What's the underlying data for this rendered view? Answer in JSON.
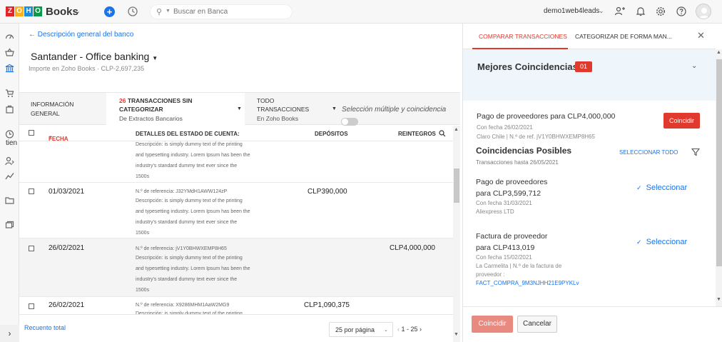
{
  "topbar": {
    "logo_letters": [
      "Z",
      "O",
      "H",
      "O"
    ],
    "logo_colors": [
      "#e42527",
      "#f9b21d",
      "#1a8cd8",
      "#089949"
    ],
    "product": "Books",
    "search_placeholder": "Buscar en Banca",
    "org_name": "demo1web4leads"
  },
  "leftnav": {
    "partial_label": "tien",
    "icons": [
      "dashboard-icon",
      "items-icon",
      "banking-icon",
      "sales-icon",
      "purchases-icon",
      "time-icon",
      "contacts-icon",
      "reports-icon",
      "documents-icon",
      "projects-icon"
    ]
  },
  "main": {
    "back_link": "Descripción general del banco",
    "account_title": "Santander - Office banking",
    "account_subtitle": "Importe en Zoho Books · CLP-2,697,235",
    "tabs": {
      "overview_l1": "INFORMACIÓN",
      "overview_l2": "GENERAL",
      "uncat_count": "26",
      "uncat_l1": "TRANSACCIONES SIN",
      "uncat_l2": "CATEGORIZAR",
      "uncat_l3": "De Extractos Bancarios",
      "all_l1": "TODO",
      "all_l2": "TRANSACCIONES",
      "all_l3": "En Zoho Books"
    },
    "multiselect_label": "Selección múltiple y coincidencia",
    "columns": {
      "date": "FECHA",
      "details": "DETALLES DEL ESTADO DE CUENTA:",
      "deposits": "DEPÓSITOS",
      "withdrawals": "REINTEGROS"
    },
    "rows": [
      {
        "date": "",
        "ref": "",
        "desc": [
          "Descripción: is simply dummy text of the printing",
          "and typesetting industry. Lorem Ipsum has been the",
          "industry's standard dummy text ever since the",
          "1500s"
        ],
        "deposit": "",
        "withdrawal": ""
      },
      {
        "date": "01/03/2021",
        "ref": "N.º de referencia: J32YMdH1AWW124zP",
        "desc": [
          "Descripción: is simply dummy text of the printing",
          "and typesetting industry. Lorem Ipsum has been the",
          "industry's standard dummy text ever since the",
          "1500s"
        ],
        "deposit": "CLP390,000",
        "withdrawal": ""
      },
      {
        "date": "26/02/2021",
        "ref": "N.º de referencia: jV1Y0BHWXEMP8H65",
        "desc": [
          "Descripción: is simply dummy text of the printing",
          "and typesetting industry. Lorem Ipsum has been the",
          "industry's standard dummy text ever since the",
          "1500s"
        ],
        "deposit": "",
        "withdrawal": "CLP4,000,000"
      },
      {
        "date": "26/02/2021",
        "ref": "N.º de referencia: X9286MHM1AaW2MG9",
        "desc": [
          "Descripción: is simply dummy text of the printing"
        ],
        "deposit": "CLP1,090,375",
        "withdrawal": ""
      }
    ],
    "footer": {
      "recount": "Recuento total",
      "per_page": "25 por página",
      "pager": "1 - 25"
    }
  },
  "panel": {
    "tab_compare": "COMPARAR TRANSACCIONES",
    "tab_categorize": "CATEGORIZAR DE FORMA MAN...",
    "best_title": "Mejores Coincidencias",
    "best_count": "01",
    "best_card": {
      "title": "Pago de proveedores para CLP4,000,000",
      "date": "Con fecha 26/02/2021",
      "meta": "Claro Chile | N.º de ref. jV1Y0BHWXEMP8H65",
      "button": "Coincidir"
    },
    "possible_title": "Coincidencias Posibles",
    "possible_sub": "Transacciones hasta 26/05/2021",
    "select_all": "SELECCIONAR TODO",
    "possible": [
      {
        "title_l1": "Pago de proveedores",
        "title_l2": "para CLP3,599,712",
        "date": "Con fecha 31/03/2021",
        "meta": "Aliexpress LTD",
        "meta2": "",
        "link": "",
        "select": "Seleccionar"
      },
      {
        "title_l1": "Factura de proveedor",
        "title_l2": "para CLP413,019",
        "date": "Con fecha 15/02/2021",
        "meta": "La Carmelita | N.º de la factura de",
        "meta2": "proveedor :",
        "link": "FACT_COMPRA_9M3NJHH21E9PYKLv",
        "select": "Seleccionar"
      }
    ],
    "btn_match": "Coincidir",
    "btn_cancel": "Cancelar"
  }
}
